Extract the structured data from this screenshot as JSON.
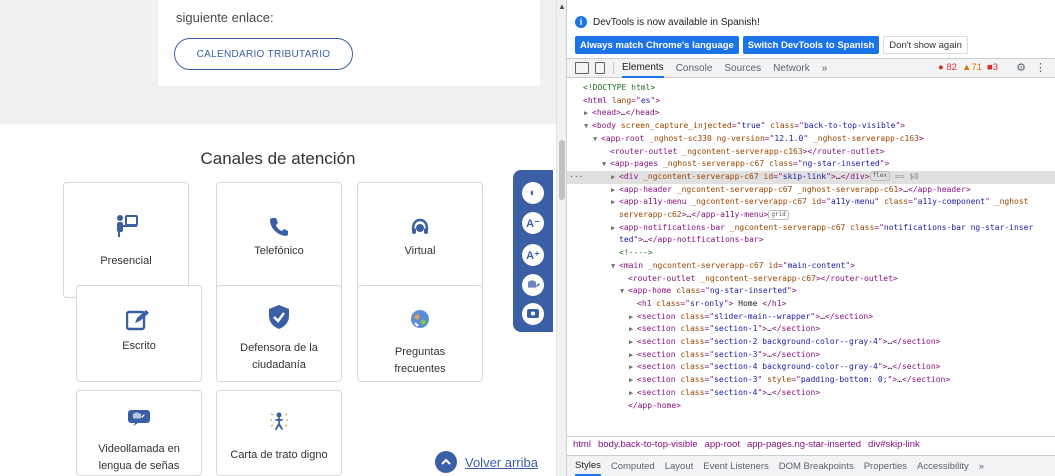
{
  "page": {
    "enlace_text": "siguiente enlace:",
    "calendar_button": "CALENDARIO TRIBUTARIO",
    "canales_title": "Canales de atención",
    "cards": [
      {
        "label": "Presencial",
        "icon": "person-desk-icon"
      },
      {
        "label": "Telefónico",
        "icon": "phone-icon"
      },
      {
        "label": "Virtual",
        "icon": "headset-icon"
      },
      {
        "label": "Escrito",
        "icon": "edit-icon"
      },
      {
        "label": "Defensora de la ciudadanía",
        "icon": "shield-check-icon"
      },
      {
        "label": "Preguntas frecuentes",
        "icon": "faq-icon"
      },
      {
        "label": "Videollamada en lengua de señas",
        "icon": "sign-language-video-icon"
      },
      {
        "label": "Carta de trato digno",
        "icon": "person-rays-icon"
      }
    ],
    "a11y_buttons": [
      {
        "icon": "contrast-icon",
        "text": "◐"
      },
      {
        "icon": "font-decrease-icon",
        "text": "A⁻"
      },
      {
        "icon": "font-increase-icon",
        "text": "A⁺"
      },
      {
        "icon": "sign-language-icon",
        "text": ""
      },
      {
        "icon": "relevo-icon",
        "text": ""
      }
    ],
    "volver_arriba": "Volver arriba",
    "accent": "#3b5fa5"
  },
  "devtools": {
    "notice": "DevTools is now available in Spanish!",
    "buttons": {
      "match": "Always match Chrome's language",
      "switch": "Switch DevTools to Spanish",
      "dont": "Don't show again"
    },
    "tabs": [
      "Elements",
      "Console",
      "Sources",
      "Network",
      "»"
    ],
    "counts": {
      "errors": "82",
      "warnings": "71",
      "issues": "3"
    },
    "tree": [
      {
        "indent": 0,
        "tri": "",
        "html": [
          [
            "cm",
            "<!DOCTYPE html>"
          ]
        ]
      },
      {
        "indent": 0,
        "tri": "",
        "html": [
          [
            "tag",
            "<html "
          ],
          [
            "an",
            "lang"
          ],
          [
            "tag",
            "=\""
          ],
          [
            "av",
            "es"
          ],
          [
            "tag",
            "\">"
          ]
        ]
      },
      {
        "indent": 1,
        "tri": "▶",
        "html": [
          [
            "tag",
            "<head>"
          ],
          [
            "tx",
            "…"
          ],
          [
            "tag",
            "</head>"
          ]
        ]
      },
      {
        "indent": 1,
        "tri": "▼",
        "html": [
          [
            "tag",
            "<body "
          ],
          [
            "an",
            "screen_capture_injected"
          ],
          [
            "tag",
            "=\""
          ],
          [
            "av",
            "true"
          ],
          [
            "tag",
            "\" "
          ],
          [
            "an",
            "class"
          ],
          [
            "tag",
            "=\""
          ],
          [
            "av",
            "back-to-top-visible"
          ],
          [
            "tag",
            "\">"
          ]
        ]
      },
      {
        "indent": 2,
        "tri": "▼",
        "html": [
          [
            "tag",
            "<app-root "
          ],
          [
            "an",
            "_nghost-sc330 ng-version"
          ],
          [
            "tag",
            "=\""
          ],
          [
            "av",
            "12.1.0"
          ],
          [
            "tag",
            "\" "
          ],
          [
            "an",
            "_nghost-serverapp-c163"
          ],
          [
            "tag",
            ">"
          ]
        ]
      },
      {
        "indent": 3,
        "tri": "",
        "html": [
          [
            "tag",
            "<router-outlet "
          ],
          [
            "an",
            "_ngcontent-serverapp-c163"
          ],
          [
            "tag",
            "></router-outlet>"
          ]
        ]
      },
      {
        "indent": 3,
        "tri": "▼",
        "html": [
          [
            "tag",
            "<app-pages "
          ],
          [
            "an",
            "_nghost-serverapp-c67 class"
          ],
          [
            "tag",
            "=\""
          ],
          [
            "av",
            "ng-star-inserted"
          ],
          [
            "tag",
            "\">"
          ]
        ]
      },
      {
        "indent": 4,
        "tri": "▶",
        "sel": true,
        "html": [
          [
            "tag",
            "<div "
          ],
          [
            "an",
            "_ngcontent-serverapp-c67 id"
          ],
          [
            "tag",
            "=\""
          ],
          [
            "av",
            "skip-link"
          ],
          [
            "tag",
            "\">"
          ],
          [
            "tx",
            "…"
          ],
          [
            "tag",
            "</div>"
          ],
          [
            "badge",
            "flex"
          ],
          [
            "eq",
            " == $0"
          ]
        ]
      },
      {
        "indent": 4,
        "tri": "▶",
        "html": [
          [
            "tag",
            "<app-header "
          ],
          [
            "an",
            "_ngcontent-serverapp-c67 _nghost-serverapp-c61"
          ],
          [
            "tag",
            ">"
          ],
          [
            "tx",
            "…"
          ],
          [
            "tag",
            "</app-header>"
          ]
        ]
      },
      {
        "indent": 4,
        "tri": "▶",
        "html": [
          [
            "tag",
            "<app-a11y-menu "
          ],
          [
            "an",
            "_ngcontent-serverapp-c67 id"
          ],
          [
            "tag",
            "=\""
          ],
          [
            "av",
            "a11y-menu"
          ],
          [
            "tag",
            "\" "
          ],
          [
            "an",
            "class"
          ],
          [
            "tag",
            "=\""
          ],
          [
            "av",
            "a11y-component"
          ],
          [
            "tag",
            "\" "
          ],
          [
            "an",
            "_nghost"
          ]
        ]
      },
      {
        "indent": 4,
        "tri": "",
        "html": [
          [
            "an",
            "serverapp-c62"
          ],
          [
            "tag",
            ">"
          ],
          [
            "tx",
            "…"
          ],
          [
            "tag",
            "</app-a11y-menu>"
          ],
          [
            "badge",
            "grid"
          ]
        ]
      },
      {
        "indent": 4,
        "tri": "▶",
        "html": [
          [
            "tag",
            "<app-notifications-bar "
          ],
          [
            "an",
            "_ngcontent-serverapp-c67 class"
          ],
          [
            "tag",
            "=\""
          ],
          [
            "av",
            "notifications-bar ng-star-inser"
          ]
        ]
      },
      {
        "indent": 4,
        "tri": "",
        "html": [
          [
            "av",
            "ted"
          ],
          [
            "tag",
            "\">"
          ],
          [
            "tx",
            "…"
          ],
          [
            "tag",
            "</app-notifications-bar>"
          ]
        ]
      },
      {
        "indent": 4,
        "tri": "",
        "html": [
          [
            "cm",
            "<!---->"
          ]
        ]
      },
      {
        "indent": 4,
        "tri": "▼",
        "html": [
          [
            "tag",
            "<main "
          ],
          [
            "an",
            "_ngcontent-serverapp-c67 id"
          ],
          [
            "tag",
            "=\""
          ],
          [
            "av",
            "main-content"
          ],
          [
            "tag",
            "\">"
          ]
        ]
      },
      {
        "indent": 5,
        "tri": "",
        "html": [
          [
            "tag",
            "<router-outlet "
          ],
          [
            "an",
            "_ngcontent-serverapp-c67"
          ],
          [
            "tag",
            "></router-outlet>"
          ]
        ]
      },
      {
        "indent": 5,
        "tri": "▼",
        "html": [
          [
            "tag",
            "<app-home "
          ],
          [
            "an",
            "class"
          ],
          [
            "tag",
            "=\""
          ],
          [
            "av",
            "ng-star-inserted"
          ],
          [
            "tag",
            "\">"
          ]
        ]
      },
      {
        "indent": 6,
        "tri": "",
        "html": [
          [
            "tag",
            "<h1 "
          ],
          [
            "an",
            "class"
          ],
          [
            "tag",
            "=\""
          ],
          [
            "av",
            "sr-only"
          ],
          [
            "tag",
            "\">"
          ],
          [
            "tx",
            " Home "
          ],
          [
            "tag",
            "</h1>"
          ]
        ]
      },
      {
        "indent": 6,
        "tri": "▶",
        "html": [
          [
            "tag",
            "<section "
          ],
          [
            "an",
            "class"
          ],
          [
            "tag",
            "=\""
          ],
          [
            "av",
            "slider-main--wrapper"
          ],
          [
            "tag",
            "\">"
          ],
          [
            "tx",
            "…"
          ],
          [
            "tag",
            "</section>"
          ]
        ]
      },
      {
        "indent": 6,
        "tri": "▶",
        "html": [
          [
            "tag",
            "<section "
          ],
          [
            "an",
            "class"
          ],
          [
            "tag",
            "=\""
          ],
          [
            "av",
            "section-1"
          ],
          [
            "tag",
            "\">"
          ],
          [
            "tx",
            "…"
          ],
          [
            "tag",
            "</section>"
          ]
        ]
      },
      {
        "indent": 6,
        "tri": "▶",
        "html": [
          [
            "tag",
            "<section "
          ],
          [
            "an",
            "class"
          ],
          [
            "tag",
            "=\""
          ],
          [
            "av",
            "section-2 background-color--gray-4"
          ],
          [
            "tag",
            "\">"
          ],
          [
            "tx",
            "…"
          ],
          [
            "tag",
            "</section>"
          ]
        ]
      },
      {
        "indent": 6,
        "tri": "▶",
        "html": [
          [
            "tag",
            "<section "
          ],
          [
            "an",
            "class"
          ],
          [
            "tag",
            "=\""
          ],
          [
            "av",
            "section-3"
          ],
          [
            "tag",
            "\">"
          ],
          [
            "tx",
            "…"
          ],
          [
            "tag",
            "</section>"
          ]
        ]
      },
      {
        "indent": 6,
        "tri": "▶",
        "html": [
          [
            "tag",
            "<section "
          ],
          [
            "an",
            "class"
          ],
          [
            "tag",
            "=\""
          ],
          [
            "av",
            "section-4 background-color--gray-4"
          ],
          [
            "tag",
            "\">"
          ],
          [
            "tx",
            "…"
          ],
          [
            "tag",
            "</section>"
          ]
        ]
      },
      {
        "indent": 6,
        "tri": "▶",
        "html": [
          [
            "tag",
            "<section "
          ],
          [
            "an",
            "class"
          ],
          [
            "tag",
            "=\""
          ],
          [
            "av",
            "section-3"
          ],
          [
            "tag",
            "\" "
          ],
          [
            "an",
            "style"
          ],
          [
            "tag",
            "=\""
          ],
          [
            "av",
            "padding-bottom: 0;"
          ],
          [
            "tag",
            "\">"
          ],
          [
            "tx",
            "…"
          ],
          [
            "tag",
            "</section>"
          ]
        ]
      },
      {
        "indent": 6,
        "tri": "▶",
        "html": [
          [
            "tag",
            "<section "
          ],
          [
            "an",
            "class"
          ],
          [
            "tag",
            "=\""
          ],
          [
            "av",
            "section-4"
          ],
          [
            "tag",
            "\">"
          ],
          [
            "tx",
            "…"
          ],
          [
            "tag",
            "</section>"
          ]
        ]
      },
      {
        "indent": 5,
        "tri": "",
        "html": [
          [
            "tag",
            "</app-home>"
          ]
        ]
      }
    ],
    "breadcrumbs": [
      "html",
      "body.back-to-top-visible",
      "app-root",
      "app-pages.ng-star-inserted",
      "div#skip-link"
    ],
    "bottom_tabs": [
      "Styles",
      "Computed",
      "Layout",
      "Event Listeners",
      "DOM Breakpoints",
      "Properties",
      "Accessibility",
      "»"
    ]
  }
}
